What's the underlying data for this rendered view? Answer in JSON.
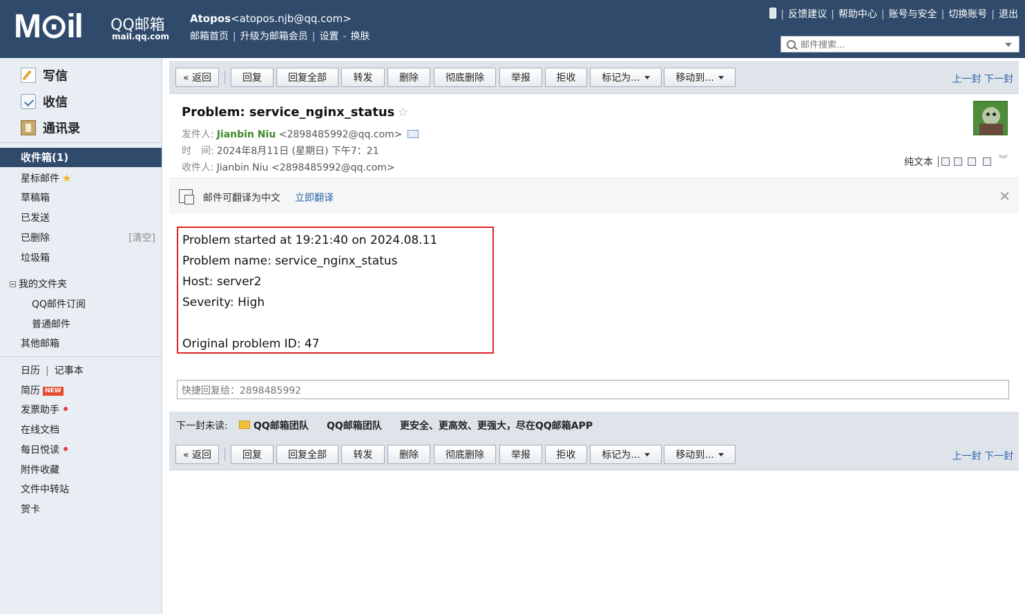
{
  "header": {
    "logo_text": "M⊙il",
    "brand_cn": "QQ邮箱",
    "brand_domain": "mail.qq.com",
    "account_name": "Atopos",
    "account_email": "<atopos.njb@qq.com>",
    "links": [
      "邮箱首页",
      "升级为邮箱会员",
      "设置",
      "换肤"
    ],
    "right_links": [
      "反馈建议",
      "帮助中心",
      "账号与安全",
      "切换账号",
      "退出"
    ],
    "search_placeholder": "邮件搜索..."
  },
  "sidebar": {
    "write": "写信",
    "inbox": "收信",
    "contacts": "通讯录",
    "inbox_bar": "收件箱(1)",
    "starred": "星标邮件",
    "drafts": "草稿箱",
    "sent": "已发送",
    "deleted": "已删除",
    "clear": "[清空]",
    "spam": "垃圾箱",
    "my_folders": "我的文件夹",
    "qq_subscribe": "QQ邮件订阅",
    "normal_mail": "普通邮件",
    "other_mailbox": "其他邮箱",
    "calendar": "日历",
    "notepad": "记事本",
    "resume": "简历",
    "resume_badge": "NEW",
    "invoice": "发票助手",
    "online_docs": "在线文档",
    "daily_read": "每日悦读",
    "attachments": "附件收藏",
    "file_transfer": "文件中转站",
    "cards": "贺卡"
  },
  "toolbar": {
    "back": "« 返回",
    "reply": "回复",
    "reply_all": "回复全部",
    "forward": "转发",
    "delete": "删除",
    "perm_delete": "彻底删除",
    "report": "举报",
    "reject": "拒收",
    "mark_as": "标记为...",
    "move_to": "移动到...",
    "prev": "上一封",
    "next": "下一封"
  },
  "mail": {
    "subject": "Problem: service_nginx_status",
    "from_label": "发件人:",
    "from_name": "Jianbin Niu",
    "from_email": "<2898485992@qq.com>",
    "time_label": "时　间:",
    "time_value": "2024年8月11日 (星期日) 下午7：21",
    "to_label": "收件人:",
    "to_value": "Jianbin Niu <2898485992@qq.com>",
    "plain_text": "纯文本",
    "translate_text": "邮件可翻译为中文",
    "translate_link": "立即翻译",
    "body": {
      "line1": "Problem started at 19:21:40 on 2024.08.11",
      "line2": "Problem name: service_nginx_status",
      "line3": "Host: server2",
      "line4": "Severity: High",
      "line5": "",
      "line6": "Original problem ID: 47"
    },
    "quick_reply_placeholder": "快捷回复给：2898485992",
    "next_unread_label": "下一封未读:",
    "next_unread_sender": "QQ邮箱团队",
    "next_unread_sender2": "QQ邮箱团队",
    "next_unread_subject": "更安全、更高效、更强大，尽在QQ邮箱APP"
  },
  "colors": {
    "header_bg": "#2f4a6b",
    "sidebar_bg": "#e9eef4",
    "toolbar_bg": "#dfe4ea",
    "link": "#3063a8",
    "sender": "#3a8a2a",
    "highlight_box": "#dd2222"
  }
}
